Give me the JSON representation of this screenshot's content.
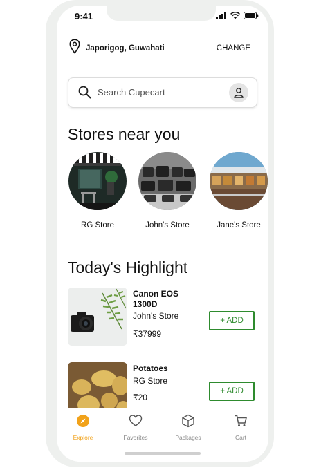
{
  "status": {
    "time": "9:41"
  },
  "location": {
    "name": "Japorigog, Guwahati",
    "change_label": "CHANGE"
  },
  "search": {
    "placeholder": "Search Cupecart"
  },
  "stores_section": {
    "title": "Stores near you",
    "stores": [
      {
        "name": "RG Store"
      },
      {
        "name": "John's Store"
      },
      {
        "name": "Jane's Store"
      }
    ]
  },
  "highlight_section": {
    "title": "Today's Highlight",
    "products": [
      {
        "name": "Canon EOS 1300D",
        "store": "John's Store",
        "price": "₹37999",
        "add_label": "+ ADD"
      },
      {
        "name": "Potatoes",
        "store": "RG Store",
        "price": "₹20",
        "add_label": "+ ADD"
      }
    ]
  },
  "nav": {
    "items": [
      {
        "label": "Explore",
        "icon": "explore-icon",
        "active": true
      },
      {
        "label": "Favorites",
        "icon": "heart-icon",
        "active": false
      },
      {
        "label": "Packages",
        "icon": "package-icon",
        "active": false
      },
      {
        "label": "Cart",
        "icon": "cart-icon",
        "active": false
      }
    ]
  },
  "colors": {
    "accent": "#f1a21a",
    "add_button": "#2e8b2e"
  }
}
